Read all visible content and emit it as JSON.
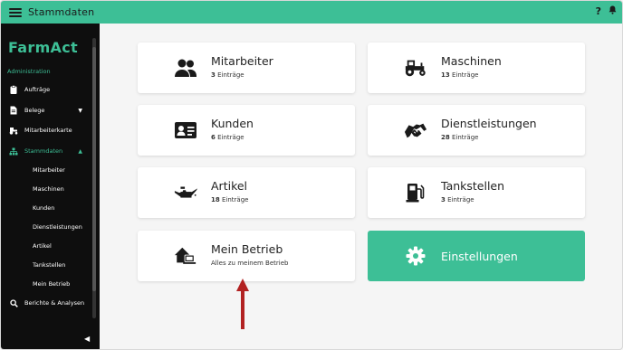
{
  "topbar": {
    "title": "Stammdaten",
    "help": "?",
    "bell_icon": "bell-icon"
  },
  "sidebar": {
    "logo": "FarmAct",
    "section": "Administration",
    "items": [
      {
        "label": "Aufträge",
        "icon": "clipboard-icon"
      },
      {
        "label": "Belege",
        "icon": "document-icon"
      },
      {
        "label": "Mitarbeiterkarte",
        "icon": "tractor-icon"
      },
      {
        "label": "Stammdaten",
        "icon": "sitemap-icon"
      },
      {
        "label": "Berichte & Analysen",
        "icon": "search-icon"
      }
    ],
    "sub_items": [
      "Mitarbeiter",
      "Maschinen",
      "Kunden",
      "Dienstleistungen",
      "Artikel",
      "Tankstellen",
      "Mein Betrieb"
    ],
    "collapse_icon": "chevron-left-icon"
  },
  "cards": {
    "mitarbeiter": {
      "title": "Mitarbeiter",
      "count": "3",
      "suffix": " Einträge"
    },
    "maschinen": {
      "title": "Maschinen",
      "count": "13",
      "suffix": " Einträge"
    },
    "kunden": {
      "title": "Kunden",
      "count": "6",
      "suffix": " Einträge"
    },
    "dienstleistungen": {
      "title": "Dienstleistungen",
      "count": "28",
      "suffix": " Einträge"
    },
    "artikel": {
      "title": "Artikel",
      "count": "18",
      "suffix": " Einträge"
    },
    "tankstellen": {
      "title": "Tankstellen",
      "count": "3",
      "suffix": " Einträge"
    },
    "mein_betrieb": {
      "title": "Mein Betrieb",
      "subtitle": "Alles zu meinem Betrieb"
    },
    "einstellungen": {
      "title": "Einstellungen"
    }
  },
  "colors": {
    "accent": "#3dbf96",
    "sidebar_bg": "#0e0e0e",
    "arrow": "#b22222"
  }
}
